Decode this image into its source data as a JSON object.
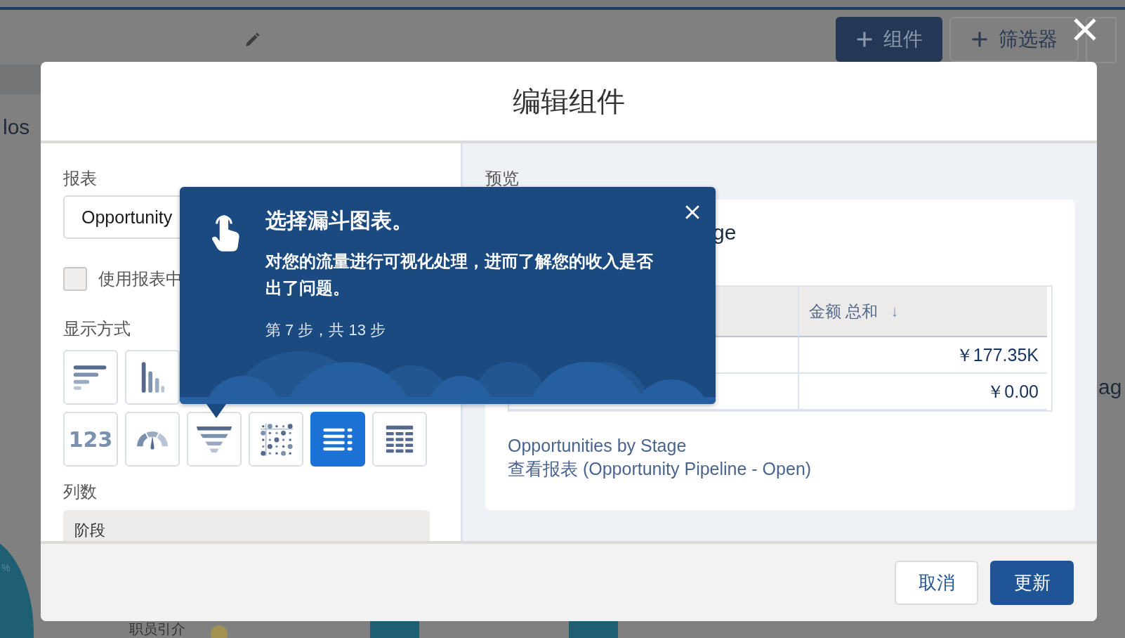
{
  "background": {
    "left_heading": "los",
    "right_heading": "ag",
    "legend_label": "职员引介",
    "percent": "%"
  },
  "toolbar": {
    "buttons": [
      {
        "label": "组件",
        "kind": "primary"
      },
      {
        "label": "筛选器",
        "kind": "neutral"
      }
    ]
  },
  "modal": {
    "title": "编辑组件",
    "report": {
      "label": "报表",
      "value": "Opportunity"
    },
    "checkbox": {
      "label": "使用报表中",
      "checked": false
    },
    "display": {
      "label": "显示方式",
      "types": [
        {
          "kind": "hbar",
          "selected": false
        },
        {
          "kind": "vbar",
          "selected": false
        },
        {
          "kind": "metric",
          "label": "123",
          "selected": false
        },
        {
          "kind": "gauge",
          "selected": false
        },
        {
          "kind": "funnel",
          "selected": false
        },
        {
          "kind": "scatter",
          "selected": false
        },
        {
          "kind": "list",
          "selected": true
        },
        {
          "kind": "table",
          "selected": false
        }
      ]
    },
    "columns": {
      "label": "列数",
      "first": "阶段"
    },
    "preview": {
      "label": "预览",
      "card_title": "ge",
      "table": {
        "header": "金额 总和",
        "sort_icon": "↓",
        "rows": [
          "￥177.35K",
          "￥0.00"
        ]
      },
      "links": [
        "Opportunities by Stage",
        "查看报表 (Opportunity Pipeline - Open)"
      ]
    },
    "buttons": [
      {
        "label": "取消",
        "kind": "neutral"
      },
      {
        "label": "更新",
        "kind": "brand"
      }
    ]
  },
  "popover": {
    "title": "选择漏斗图表。",
    "body": "对您的流量进行可视化处理，进而了解您的收入是否出了问题。",
    "step": "第 7 步，共 13 步"
  }
}
